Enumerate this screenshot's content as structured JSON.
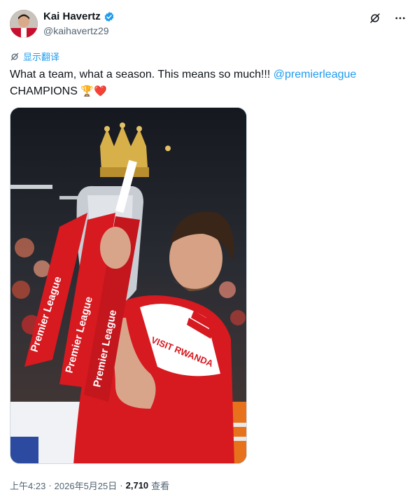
{
  "author": {
    "display_name": "Kai Havertz",
    "handle": "@kaihavertz29",
    "verified": true
  },
  "top_actions": {
    "grok_icon": "grok-icon",
    "more_icon": "more-icon"
  },
  "translate_label": "显示翻译",
  "tweet": {
    "text_part1": "What a team, what a season. This means so much!!! ",
    "mention": "@premierleague",
    "text_part2": "CHAMPIONS ",
    "emojis": "🏆❤️"
  },
  "media": {
    "alt": "photo",
    "banner_words": [
      "Premier League",
      "Premier League",
      "Premier League"
    ],
    "shirt_text": "VISIT RWANDA"
  },
  "meta": {
    "time": "上午4:23",
    "date": "2026年5月25日",
    "views_count": "2,710",
    "views_label": "查看",
    "sep": "·"
  },
  "colors": {
    "link": "#1d9bf0",
    "verified": "#1d9bf0",
    "text": "#0f1419",
    "muted": "#536471"
  }
}
